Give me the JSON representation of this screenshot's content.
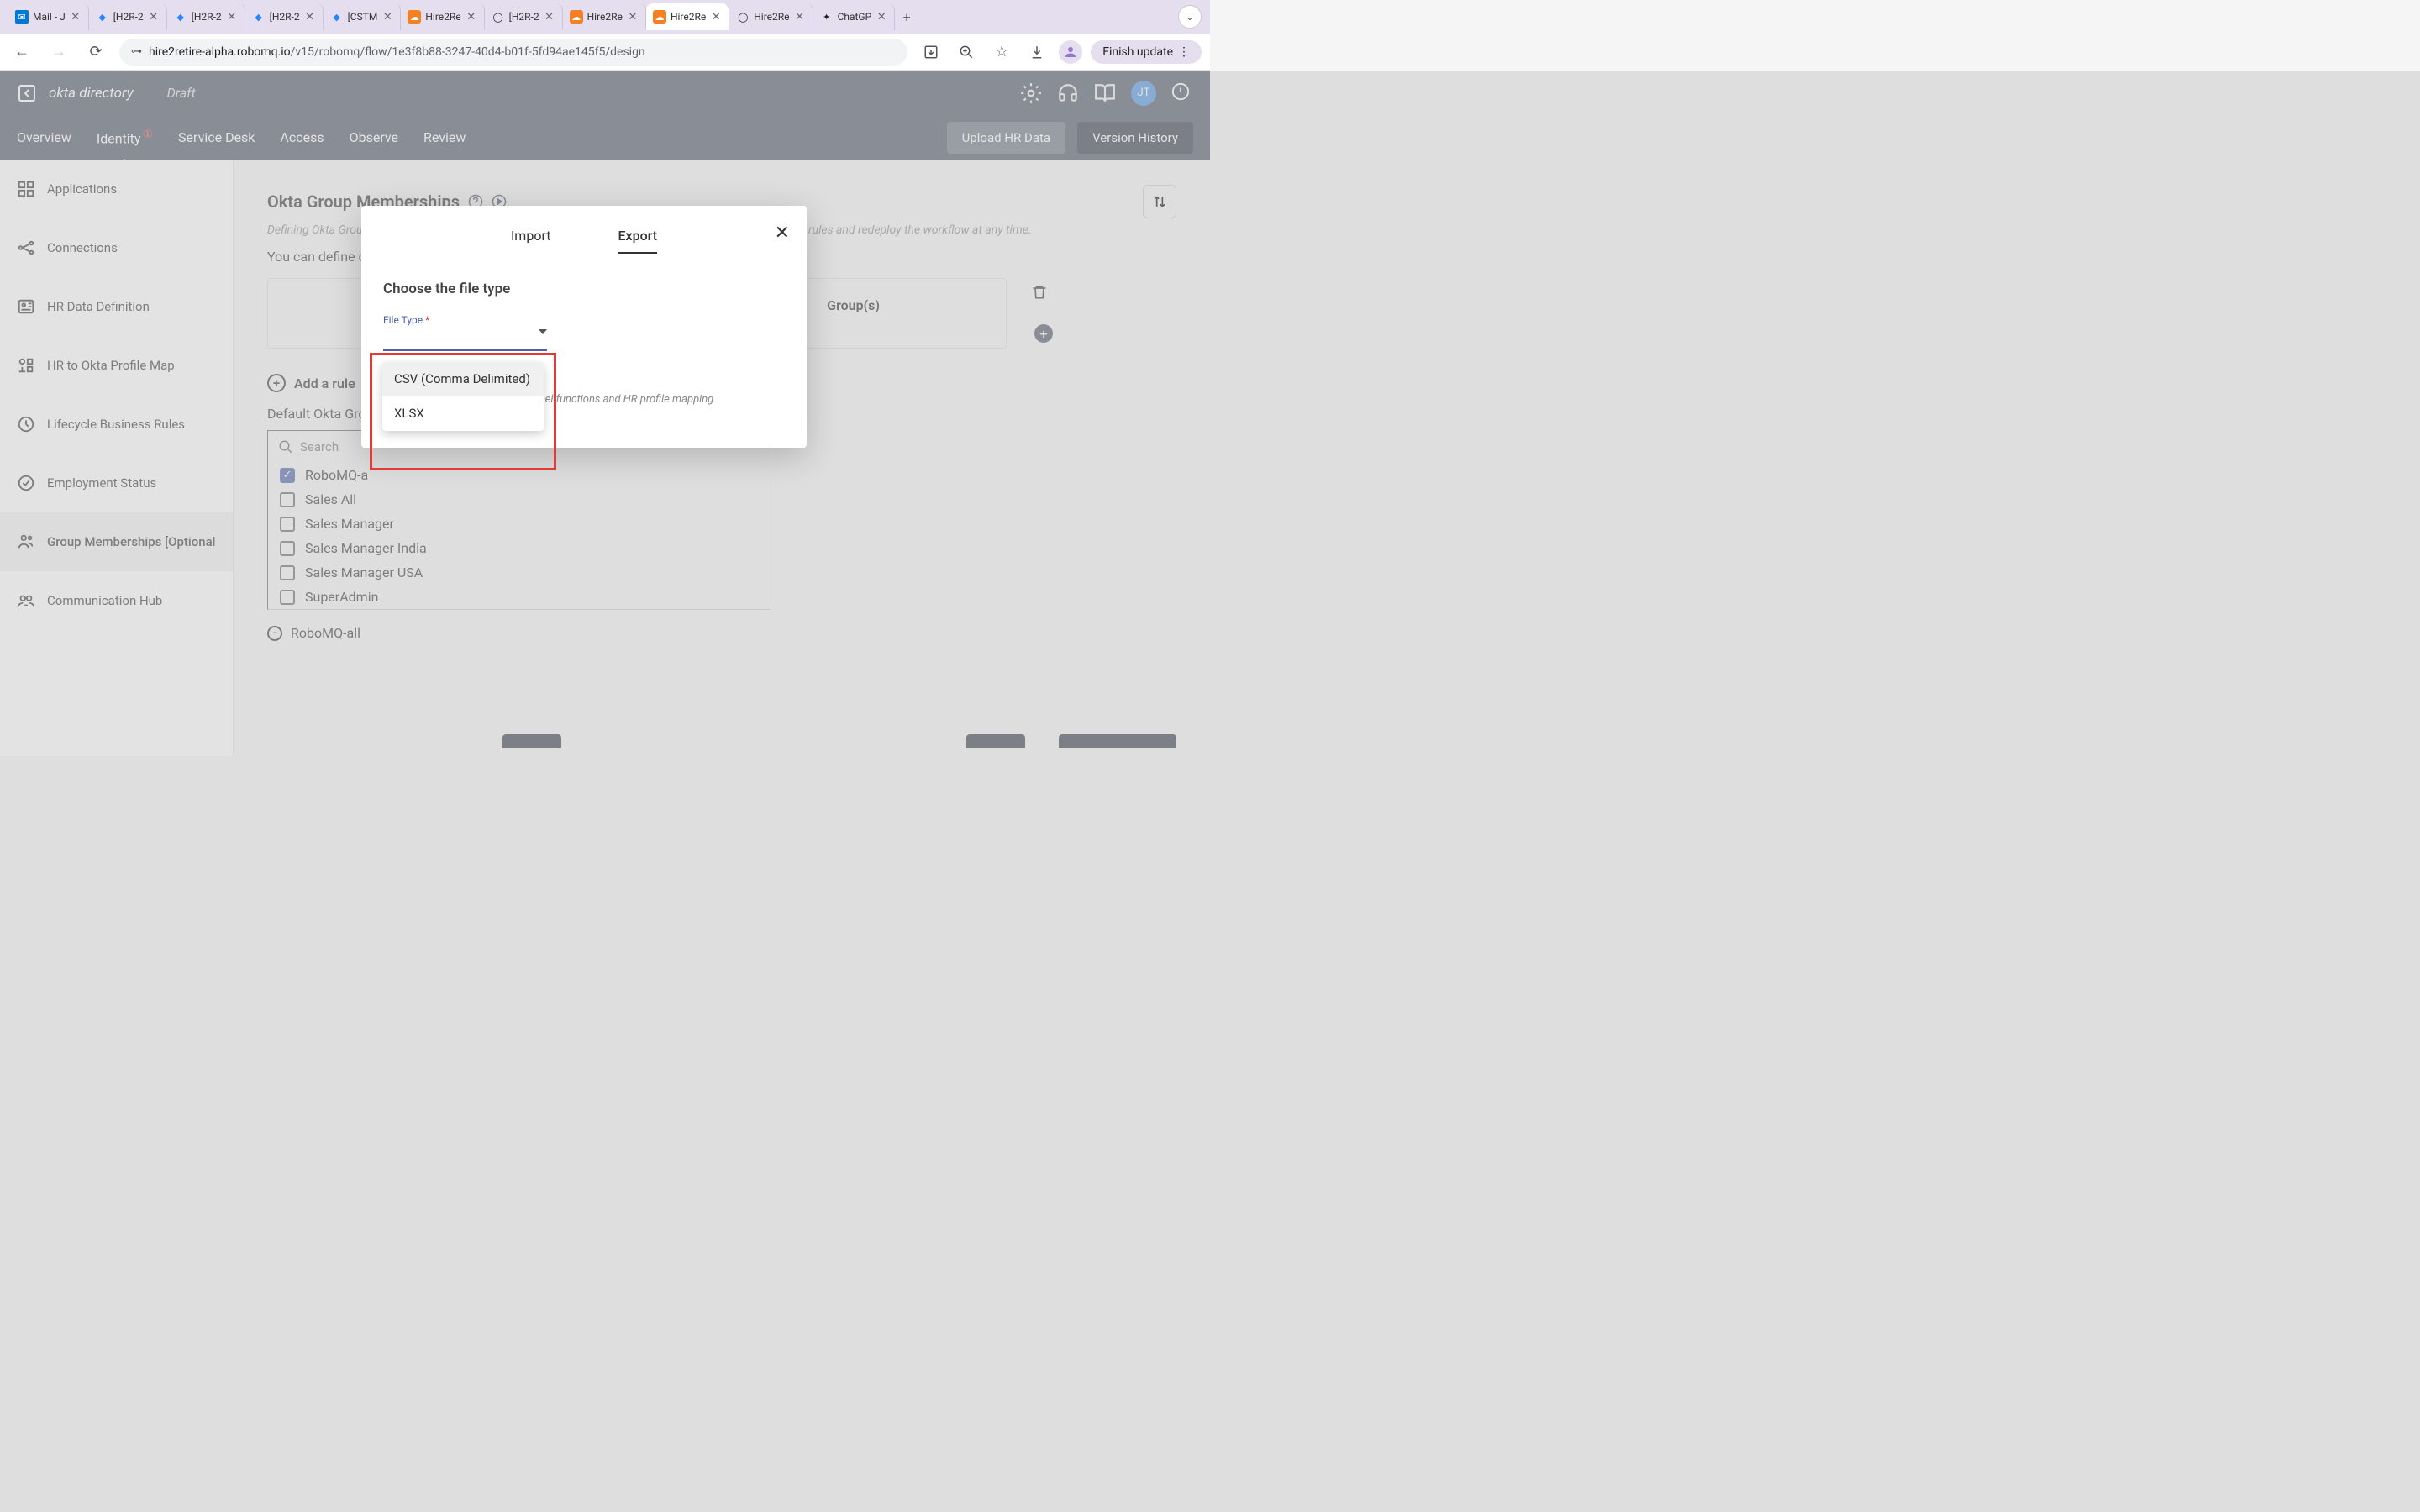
{
  "browser": {
    "tabs": [
      {
        "title": "Mail - J",
        "favicon": "📧",
        "favicon_bg": "#0078d4"
      },
      {
        "title": "[H2R-2",
        "favicon": "◆",
        "favicon_bg": "#2684ff"
      },
      {
        "title": "[H2R-2",
        "favicon": "◆",
        "favicon_bg": "#2684ff"
      },
      {
        "title": "[H2R-2",
        "favicon": "◆",
        "favicon_bg": "#2684ff"
      },
      {
        "title": "[CSTM",
        "favicon": "◆",
        "favicon_bg": "#2684ff"
      },
      {
        "title": "Hire2Re",
        "favicon": "☁",
        "favicon_bg": "#f48024"
      },
      {
        "title": "[H2R-2",
        "favicon": "◯",
        "favicon_bg": "#24292e"
      },
      {
        "title": "Hire2Re",
        "favicon": "☁",
        "favicon_bg": "#f48024"
      },
      {
        "title": "Hire2Re",
        "favicon": "☁",
        "favicon_bg": "#f48024",
        "active": true
      },
      {
        "title": "Hire2Re",
        "favicon": "◯",
        "favicon_bg": "#24292e"
      },
      {
        "title": "ChatGP",
        "favicon": "✦",
        "favicon_bg": "#202123"
      }
    ],
    "url_host": "hire2retire-alpha.robomq.io",
    "url_path": "/v15/robomq/flow/1e3f8b88-3247-40d4-b01f-5fd94ae145f5/design",
    "finish_update": "Finish update"
  },
  "header": {
    "title": "okta directory",
    "status": "Draft",
    "user_initials": "JT"
  },
  "app_tabs": {
    "items": [
      "Overview",
      "Identity",
      "Service Desk",
      "Access",
      "Observe",
      "Review"
    ],
    "active": "Identity",
    "upload_btn": "Upload HR Data",
    "version_btn": "Version History"
  },
  "sidebar": {
    "items": [
      {
        "label": "Applications",
        "icon": "apps"
      },
      {
        "label": "Connections",
        "icon": "connections"
      },
      {
        "label": "HR Data Definition",
        "icon": "hr-data"
      },
      {
        "label": "HR to Okta Profile Map",
        "icon": "profile-map"
      },
      {
        "label": "Lifecycle Business Rules",
        "icon": "lifecycle"
      },
      {
        "label": "Employment Status",
        "icon": "employment"
      },
      {
        "label": "Group Memberships [Optional",
        "icon": "groups",
        "active": true
      },
      {
        "label": "Communication Hub",
        "icon": "comm"
      }
    ]
  },
  "content": {
    "title": "Okta Group Memberships",
    "subtitle": "Defining Okta Group (OG) assignments rules is optional. You can progressively add okta group assignment rules and redeploy the workflow at any time.",
    "desc": "You can define complex mappings by adding AND/OR conditions.",
    "rule_right": "Group(s)",
    "add_rule": "Add a rule",
    "default_label": "Default Okta Gro",
    "search_placeholder": "Search",
    "groups": [
      {
        "name": "RoboMQ-a",
        "checked": true
      },
      {
        "name": "Sales All",
        "checked": false
      },
      {
        "name": "Sales Manager",
        "checked": false
      },
      {
        "name": "Sales Manager India",
        "checked": false
      },
      {
        "name": "Sales Manager USA",
        "checked": false
      },
      {
        "name": "SuperAdmin",
        "checked": false
      }
    ],
    "selected": "RoboMQ-all"
  },
  "modal": {
    "import_tab": "Import",
    "export_tab": "Export",
    "heading": "Choose the file type",
    "field_label": "File Type",
    "helper": "xcel functions and HR profile mapping",
    "options": [
      "CSV (Comma Delimited)",
      "XLSX"
    ]
  }
}
